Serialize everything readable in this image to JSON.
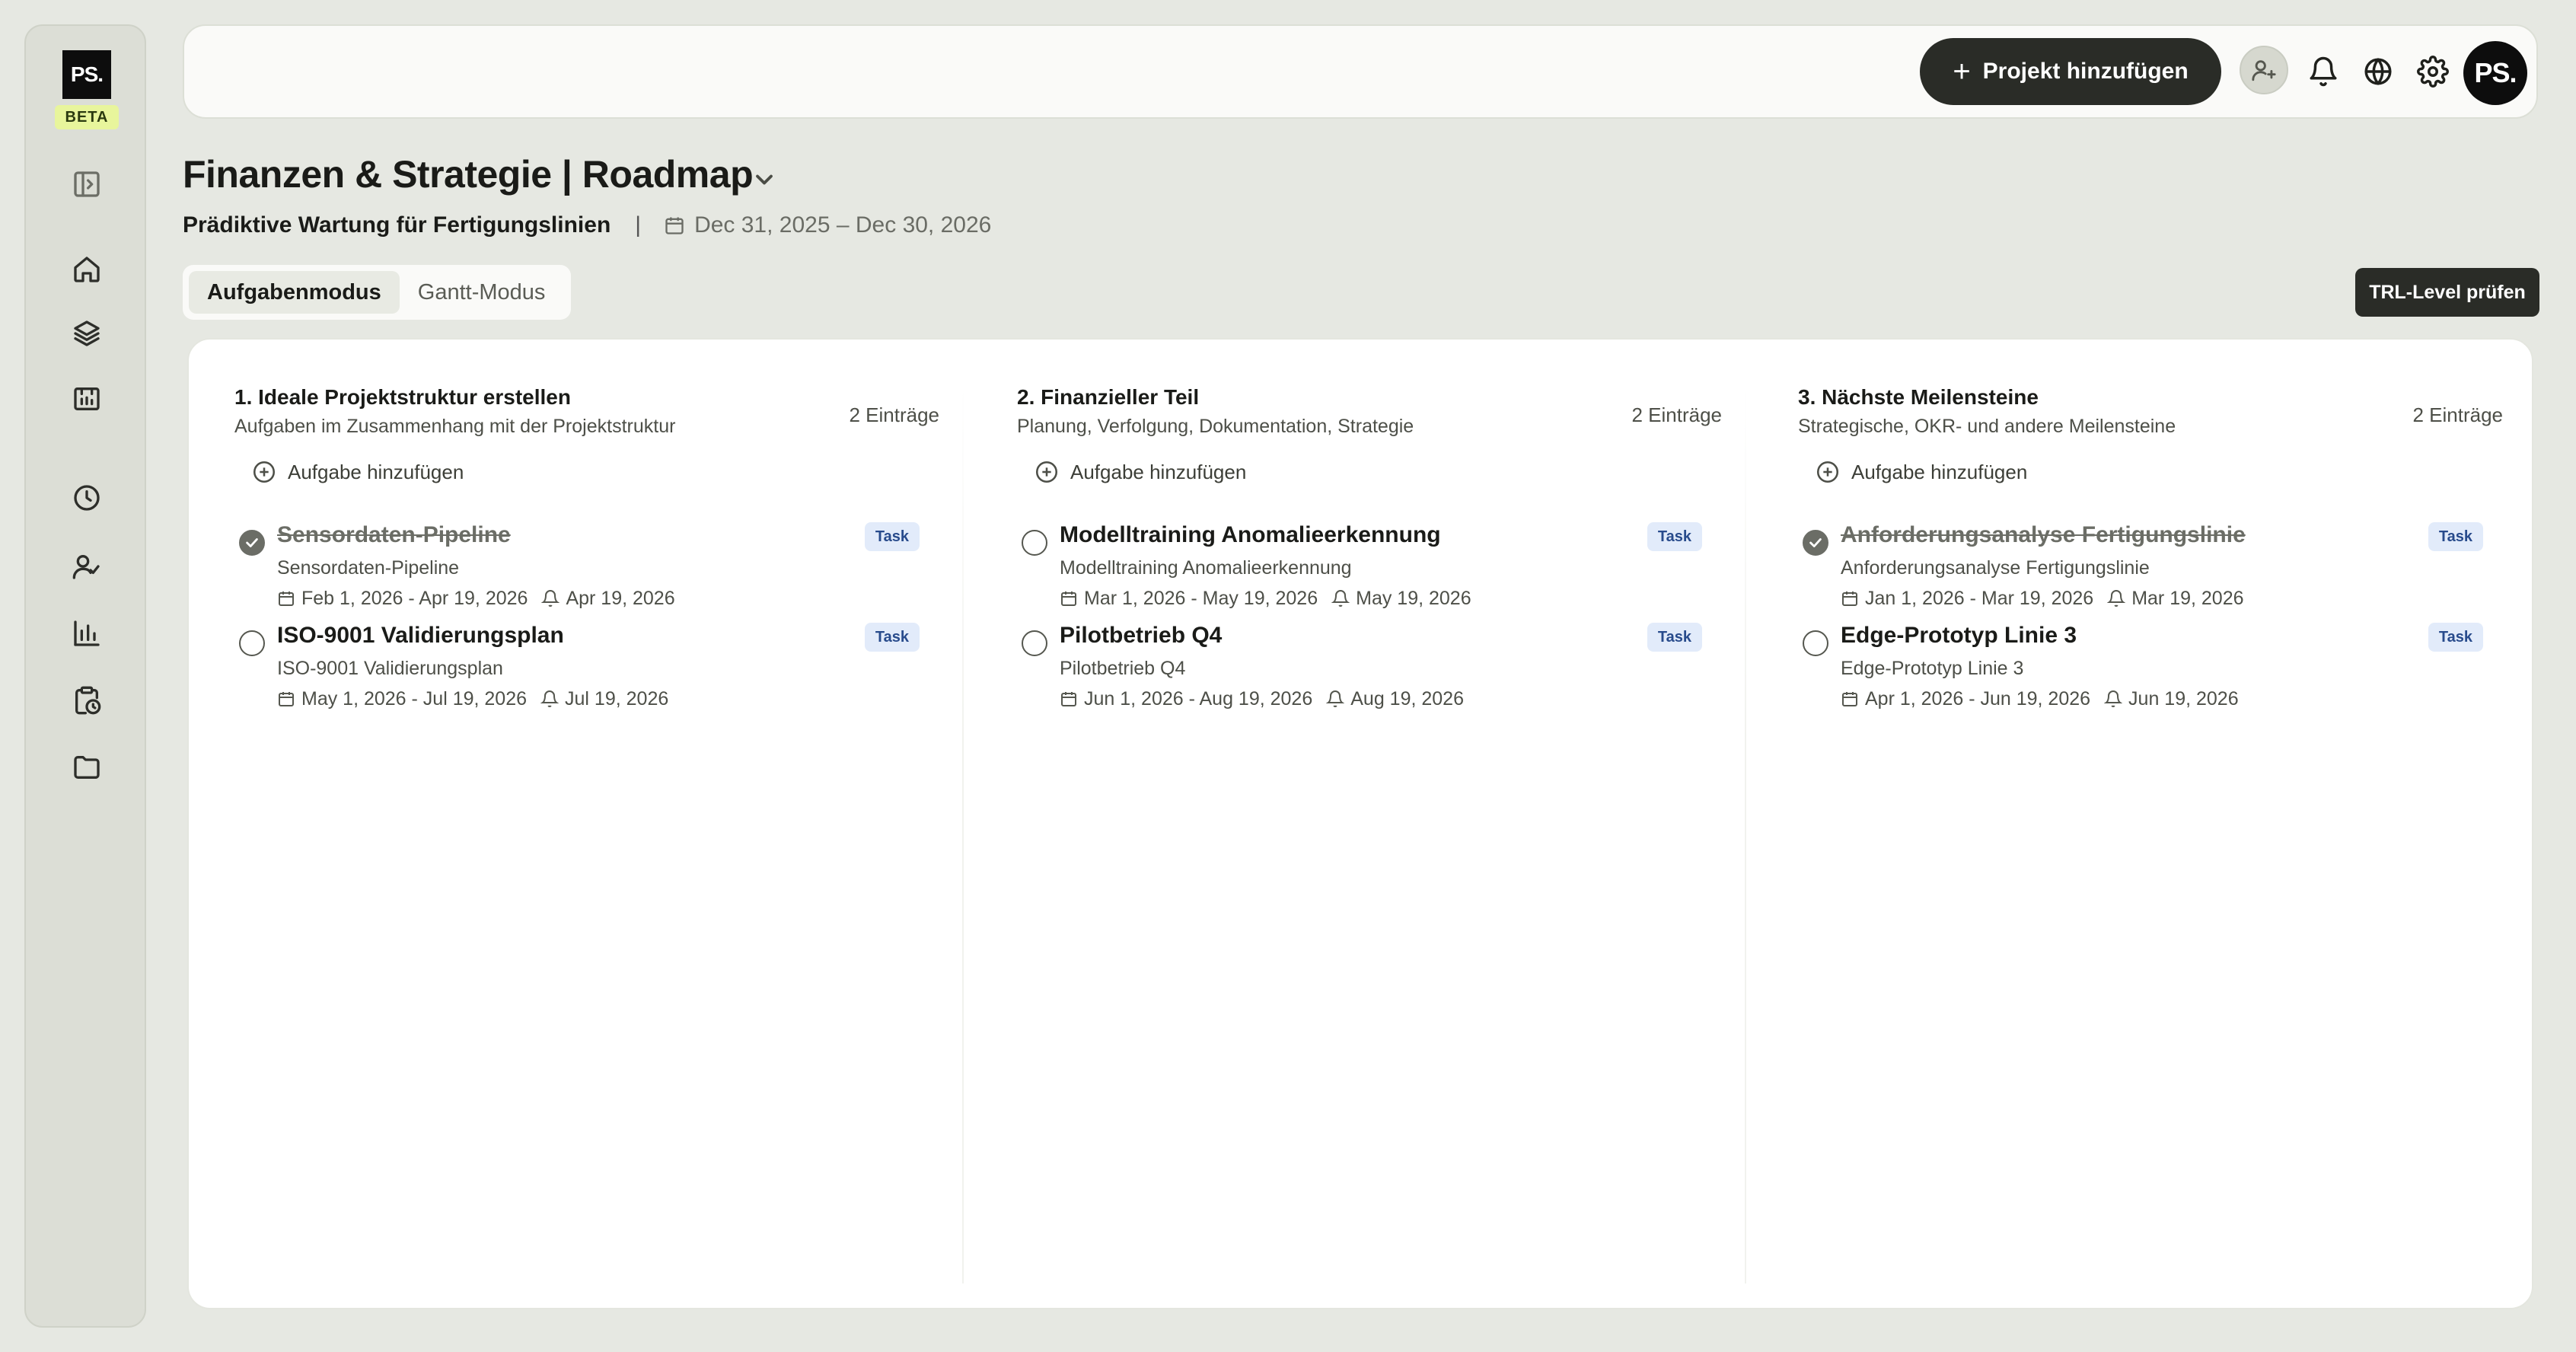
{
  "sidebar": {
    "logo_text": "PS.",
    "beta_label": "BETA",
    "icons": [
      "panel-toggle-icon",
      "home-icon",
      "layers-icon",
      "roadmap-icon",
      "clock-icon",
      "user-check-icon",
      "chart-icon",
      "clipboard-clock-icon",
      "folder-icon"
    ]
  },
  "topbar": {
    "add_project_label": "Projekt hinzufügen",
    "avatar_initials": "PS."
  },
  "header": {
    "title": "Finanzen & Strategie | Roadmap",
    "project_name": "Prädiktive Wartung für Fertigungslinien",
    "separator": "|",
    "date_range": "Dec 31, 2025 – Dec 30, 2026"
  },
  "modes": {
    "task_mode": "Aufgabenmodus",
    "gantt_mode": "Gantt-Modus",
    "active": "task_mode"
  },
  "trl_button": "TRL-Level prüfen",
  "columns": [
    {
      "title": "1. Ideale Projektstruktur erstellen",
      "subtitle": "Aufgaben im Zusammenhang mit der Projektstruktur",
      "count": "2 Einträge",
      "add_label": "Aufgabe hinzufügen",
      "tasks": [
        {
          "title": "Sensordaten-Pipeline",
          "subtitle": "Sensordaten-Pipeline",
          "range": "Feb 1, 2026 - Apr 19, 2026",
          "reminder": "Apr 19, 2026",
          "badge": "Task",
          "done": true
        },
        {
          "title": "ISO-9001 Validierungsplan",
          "subtitle": "ISO-9001 Validierungsplan",
          "range": "May 1, 2026 - Jul 19, 2026",
          "reminder": "Jul 19, 2026",
          "badge": "Task",
          "done": false
        }
      ]
    },
    {
      "title": "2. Finanzieller Teil",
      "subtitle": "Planung, Verfolgung, Dokumentation, Strategie",
      "count": "2 Einträge",
      "add_label": "Aufgabe hinzufügen",
      "tasks": [
        {
          "title": "Modelltraining Anomalieerkennung",
          "subtitle": "Modelltraining Anomalieerkennung",
          "range": "Mar 1, 2026 - May 19, 2026",
          "reminder": "May 19, 2026",
          "badge": "Task",
          "done": false
        },
        {
          "title": "Pilotbetrieb Q4",
          "subtitle": "Pilotbetrieb Q4",
          "range": "Jun 1, 2026 - Aug 19, 2026",
          "reminder": "Aug 19, 2026",
          "badge": "Task",
          "done": false
        }
      ]
    },
    {
      "title": "3. Nächste Meilensteine",
      "subtitle": "Strategische, OKR- und andere Meilensteine",
      "count": "2 Einträge",
      "add_label": "Aufgabe hinzufügen",
      "tasks": [
        {
          "title": "Anforderungsanalyse Fertigungslinie",
          "subtitle": "Anforderungsanalyse Fertigungslinie",
          "range": "Jan 1, 2026 - Mar 19, 2026",
          "reminder": "Mar 19, 2026",
          "badge": "Task",
          "done": true
        },
        {
          "title": "Edge-Prototyp Linie 3",
          "subtitle": "Edge-Prototyp Linie 3",
          "range": "Apr 1, 2026 - Jun 19, 2026",
          "reminder": "Jun 19, 2026",
          "badge": "Task",
          "done": false
        }
      ]
    }
  ]
}
